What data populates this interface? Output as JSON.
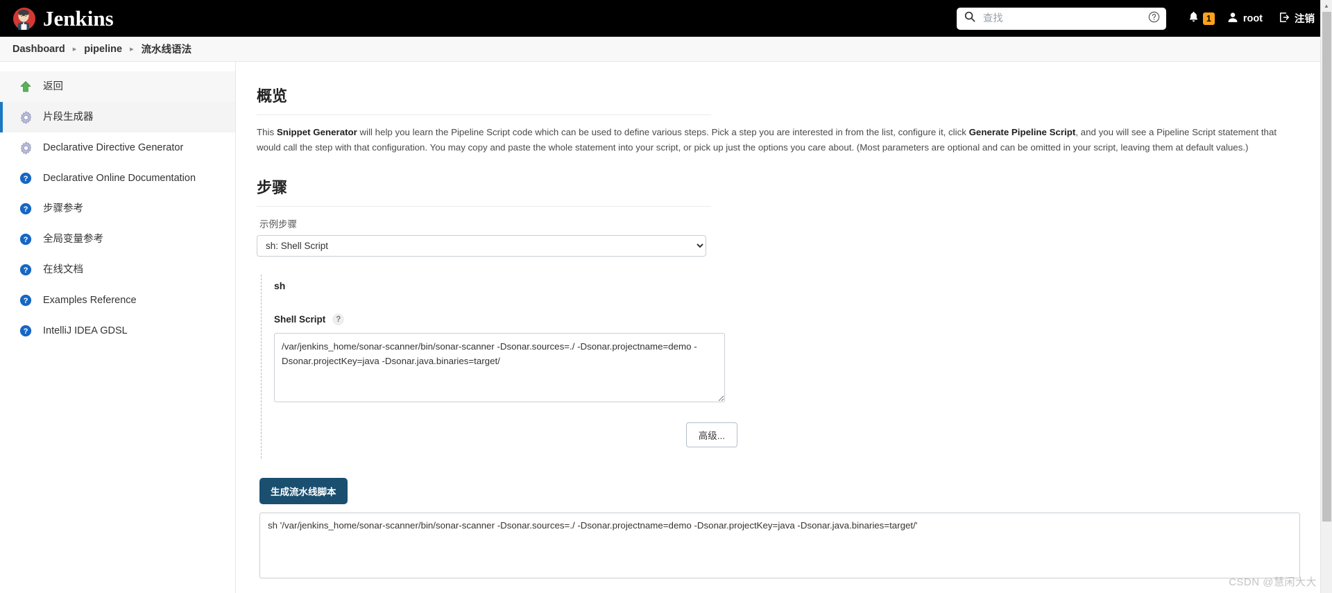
{
  "header": {
    "brand": "Jenkins",
    "logo_icon": "jenkins-butler-logo",
    "search": {
      "icon": "search-icon",
      "placeholder": "查找",
      "value": "",
      "help_icon": "question-circle-icon"
    },
    "notifications": {
      "icon": "bell-icon",
      "count": "1",
      "badge_color": "#fca21c"
    },
    "user": {
      "icon": "person-icon",
      "name": "root"
    },
    "logout": {
      "icon": "logout-arrow-icon",
      "label": "注销"
    }
  },
  "breadcrumb": {
    "items": [
      {
        "label": "Dashboard"
      },
      {
        "label": "pipeline"
      },
      {
        "label": "流水线语法"
      }
    ],
    "separator": "▸"
  },
  "sidebar": {
    "items": [
      {
        "label": "返回",
        "icon": "green-up-arrow-icon",
        "active": false
      },
      {
        "label": "片段生成器",
        "icon": "gear-icon",
        "active": true
      },
      {
        "label": "Declarative Directive Generator",
        "icon": "gear-icon",
        "active": false
      },
      {
        "label": "Declarative Online Documentation",
        "icon": "help-circle-icon",
        "active": false
      },
      {
        "label": "步骤参考",
        "icon": "help-circle-icon",
        "active": false
      },
      {
        "label": "全局变量参考",
        "icon": "help-circle-icon",
        "active": false
      },
      {
        "label": "在线文档",
        "icon": "help-circle-icon",
        "active": false
      },
      {
        "label": "Examples Reference",
        "icon": "help-circle-icon",
        "active": false
      },
      {
        "label": "IntelliJ IDEA GDSL",
        "icon": "help-circle-icon",
        "active": false
      }
    ]
  },
  "main": {
    "overview": {
      "title": "概览",
      "text_1": "This ",
      "bold_1": "Snippet Generator",
      "text_2": " will help you learn the Pipeline Script code which can be used to define various steps. Pick a step you are interested in from the list, configure it, click ",
      "bold_2": "Generate Pipeline Script",
      "text_3": ", and you will see a Pipeline Script statement that would call the step with that configuration. You may copy and paste the whole statement into your script, or pick up just the options you care about. (Most parameters are optional and can be omitted in your script, leaving them at default values.)"
    },
    "steps": {
      "title": "步骤",
      "sample_step_label": "示例步骤",
      "selected_step": "sh: Shell Script",
      "step_options": [
        "sh: Shell Script"
      ],
      "step_name": "sh",
      "shell_script_label": "Shell Script",
      "help_icon": "question-mark-icon",
      "script_value": "/var/jenkins_home/sonar-scanner/bin/sonar-scanner -Dsonar.sources=./ -Dsonar.projectname=demo -Dsonar.projectKey=java -Dsonar.java.binaries=target/",
      "advanced_button": "高级...",
      "generate_button": "生成流水线脚本",
      "output_value": "sh '/var/jenkins_home/sonar-scanner/bin/sonar-scanner -Dsonar.sources=./ -Dsonar.projectname=demo -Dsonar.projectKey=java -Dsonar.java.binaries=target/'"
    }
  },
  "watermark": "CSDN @慧闲大大"
}
